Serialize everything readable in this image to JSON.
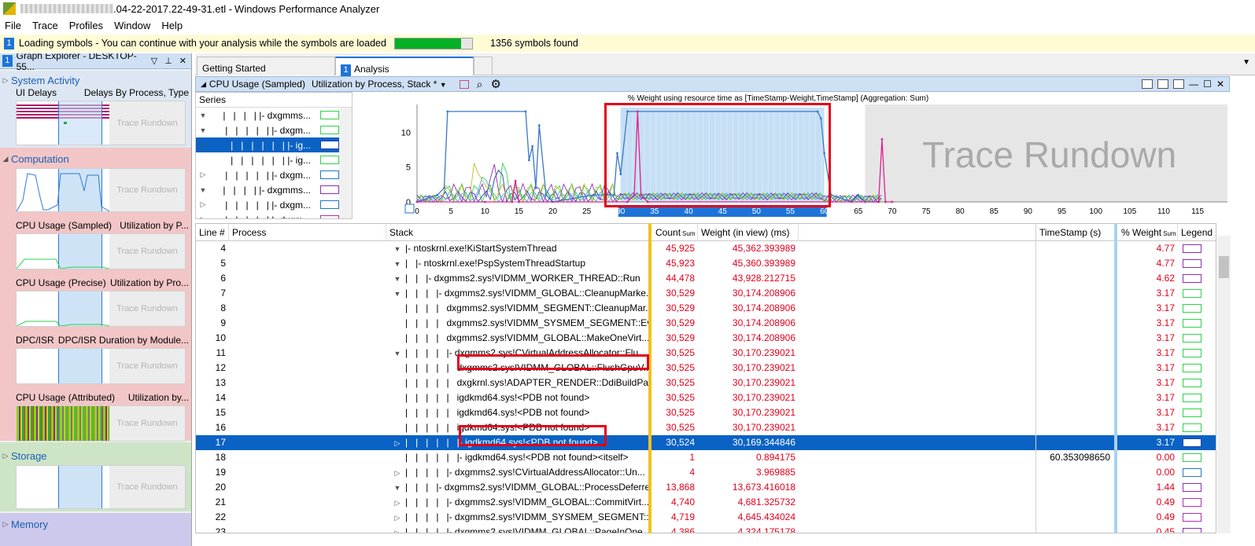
{
  "window": {
    "title_prefix": ".04-22-2017.22-49-31.etl - ",
    "title_suffix": "Windows Performance Analyzer"
  },
  "menu": [
    "File",
    "Trace",
    "Profiles",
    "Window",
    "Help"
  ],
  "info": {
    "badge": "1",
    "message": "Loading symbols - You can continue with your analysis while the symbols are loaded",
    "progress": 0.86,
    "symbols": "1356 symbols found"
  },
  "explorer": {
    "badge": "1",
    "title": "Graph Explorer - DESKTOP-55...",
    "categories": [
      {
        "name": "System Activity",
        "items": [
          {
            "name": "UI Delays",
            "detail": "Delays By Process, Type"
          }
        ]
      },
      {
        "name": "Computation",
        "items": [
          {
            "name": "CPU Usage (Sampled)",
            "detail": "Utilization by P..."
          },
          {
            "name": "CPU Usage (Precise)",
            "detail": "Utilization by Pro..."
          },
          {
            "name": "DPC/ISR",
            "detail": "DPC/ISR Duration by Module..."
          },
          {
            "name": "CPU Usage (Attributed)",
            "detail": "Utilization by..."
          }
        ]
      },
      {
        "name": "Storage",
        "items": []
      },
      {
        "name": "Memory",
        "items": []
      }
    ],
    "rundown": "Trace Rundown"
  },
  "tabs": [
    {
      "label": "Getting Started"
    },
    {
      "badge": "1",
      "label": "Analysis"
    }
  ],
  "graph": {
    "title": "CPU Usage (Sampled)",
    "preset": "Utilization by Process, Stack *",
    "series_header": "Series",
    "series": [
      {
        "label": "|- dxgmms...",
        "expand": "▼",
        "color": "#2fd24a"
      },
      {
        "label": "|- dxgm...",
        "expand": "▼",
        "color": "#2fd24a"
      },
      {
        "label": "|- ig...",
        "expand": "▷",
        "color": "#1d3fb5",
        "selected": true
      },
      {
        "label": "|- ig...",
        "expand": "",
        "color": "#2fd24a"
      },
      {
        "label": "|- dxgm...",
        "expand": "▷",
        "color": "#1f78c8"
      },
      {
        "label": "|- dxgmms...",
        "expand": "▼",
        "color": "#8a2fb8"
      },
      {
        "label": "|- dxgm...",
        "expand": "▷",
        "color": "#1f78c8"
      },
      {
        "label": "|- dxgm...",
        "expand": "▷",
        "color": "#b02fb8"
      }
    ]
  },
  "chart_data": {
    "type": "line",
    "title": "% Weight using resource time as [TimeStamp-Weight,TimeStamp] (Aggregation: Sum)",
    "xlim": [
      0,
      118
    ],
    "ylim": [
      0,
      14
    ],
    "xticks": [
      0,
      5,
      10,
      15,
      20,
      25,
      30,
      35,
      40,
      45,
      50,
      55,
      60,
      65,
      70,
      75,
      80,
      85,
      90,
      95,
      100,
      105,
      110,
      115
    ],
    "yticks": [
      0,
      5,
      10
    ],
    "selection": [
      30,
      60
    ],
    "rundown_start": 66,
    "rundown_label": "Trace Rundown",
    "series": [
      {
        "name": "top",
        "color": "#3a78c8",
        "x": [
          0,
          3,
          4,
          4.5,
          16,
          16.5,
          17,
          17.5,
          18,
          19,
          20,
          26,
          29,
          29.5,
          30,
          31,
          59,
          59.5,
          60,
          61,
          64,
          65,
          66,
          68
        ],
        "y": [
          0,
          1,
          2,
          13,
          13,
          6,
          8,
          2,
          11,
          1,
          0,
          1,
          1,
          7,
          4,
          13,
          13,
          12,
          7,
          1,
          0,
          1,
          0,
          0
        ]
      },
      {
        "name": "spikes",
        "color": "#e0208c",
        "x": [
          0,
          10,
          14,
          14.5,
          15,
          31,
          32,
          32.5,
          33,
          34,
          68,
          68.5,
          69,
          70
        ],
        "y": [
          0,
          0,
          0,
          3,
          0,
          0,
          1,
          13,
          1,
          0,
          0,
          9,
          0,
          0
        ]
      }
    ]
  },
  "table": {
    "columns": {
      "line": "Line #",
      "process": "Process",
      "stack": "Stack",
      "count": "Count",
      "count_sub": "Sum",
      "weight": "Weight (in view) (ms)",
      "timestamp": "TimeStamp (s)",
      "pct": "% Weight",
      "pct_sub": "Sum",
      "legend": "Legend"
    },
    "rows": [
      {
        "line": "4",
        "exp": "▼",
        "indent": "|- ",
        "stack": "ntoskrnl.exe!KiStartSystemThread",
        "count": "45,925",
        "weight": "45,362.393989",
        "ts": "",
        "pct": "4.77",
        "color": "#8a2fb8"
      },
      {
        "line": "5",
        "exp": "▼",
        "indent": "|   |- ",
        "stack": "ntoskrnl.exe!PspSystemThreadStartup",
        "count": "45,923",
        "weight": "45,360.393989",
        "ts": "",
        "pct": "4.77",
        "color": "#8a2fb8"
      },
      {
        "line": "6",
        "exp": "▼",
        "indent": "|   |   |- ",
        "stack": "dxgmms2.sys!VIDMM_WORKER_THREAD::Run",
        "count": "44,478",
        "weight": "43,928.212715",
        "ts": "",
        "pct": "4.62",
        "color": "#8a2fb8"
      },
      {
        "line": "7",
        "exp": "▼",
        "indent": "|   |   |   |- ",
        "stack": "dxgmms2.sys!VIDMM_GLOBAL::CleanupMarke...",
        "count": "30,529",
        "weight": "30,174.208906",
        "ts": "",
        "pct": "3.17",
        "color": "#2fd24a"
      },
      {
        "line": "8",
        "exp": "",
        "indent": "|   |   |   |   ",
        "stack": "dxgmms2.sys!VIDMM_SEGMENT::CleanupMar...",
        "count": "30,529",
        "weight": "30,174.208906",
        "ts": "",
        "pct": "3.17",
        "color": "#2fd24a"
      },
      {
        "line": "9",
        "exp": "",
        "indent": "|   |   |   |   ",
        "stack": "dxgmms2.sys!VIDMM_SYSMEM_SEGMENT::Ev...",
        "count": "30,529",
        "weight": "30,174.208906",
        "ts": "",
        "pct": "3.17",
        "color": "#2fd24a"
      },
      {
        "line": "10",
        "exp": "",
        "indent": "|   |   |   |   ",
        "stack": "dxgmms2.sys!VIDMM_GLOBAL::MakeOneVirt...",
        "count": "30,529",
        "weight": "30,174.208906",
        "ts": "",
        "pct": "3.17",
        "color": "#2fd24a"
      },
      {
        "line": "11",
        "exp": "▼",
        "indent": "|   |   |   |   |- ",
        "stack": "dxgmms2.sys!CVirtualAddressAllocator::Flu...",
        "count": "30,525",
        "weight": "30,170.239021",
        "ts": "",
        "pct": "3.17",
        "color": "#2fd24a"
      },
      {
        "line": "12",
        "exp": "",
        "indent": "|   |   |   |   |   ",
        "stack": "dxgmms2.sys!VIDMM_GLOBAL::FlushGpuV...",
        "count": "30,525",
        "weight": "30,170.239021",
        "ts": "",
        "pct": "3.17",
        "color": "#2fd24a"
      },
      {
        "line": "13",
        "exp": "",
        "indent": "|   |   |   |   |   ",
        "stack": "dxgkrnl.sys!ADAPTER_RENDER::DdiBuildPa...",
        "count": "30,525",
        "weight": "30,170.239021",
        "ts": "",
        "pct": "3.17",
        "color": "#2fd24a"
      },
      {
        "line": "14",
        "exp": "",
        "indent": "|   |   |   |   |   ",
        "stack": "igdkmd64.sys!<PDB not found>",
        "count": "30,525",
        "weight": "30,170.239021",
        "ts": "",
        "pct": "3.17",
        "color": "#2fd24a"
      },
      {
        "line": "15",
        "exp": "",
        "indent": "|   |   |   |   |   ",
        "stack": "igdkmd64.sys!<PDB not found>",
        "count": "30,525",
        "weight": "30,170.239021",
        "ts": "",
        "pct": "3.17",
        "color": "#2fd24a"
      },
      {
        "line": "16",
        "exp": "",
        "indent": "|   |   |   |   |   ",
        "stack": "igdkmd64.sys!<PDB not found>",
        "count": "30,525",
        "weight": "30,170.239021",
        "ts": "",
        "pct": "3.17",
        "color": "#2fd24a"
      },
      {
        "line": "17",
        "exp": "▷",
        "indent": "|   |   |   |   |   |- ",
        "stack": "igdkmd64.sys!<PDB not found>",
        "count": "30,524",
        "weight": "30,169.344846",
        "ts": "",
        "pct": "3.17",
        "color": "#1d3fb5",
        "selected": true
      },
      {
        "line": "18",
        "exp": "",
        "indent": "|   |   |   |   |   |- ",
        "stack": "igdkmd64.sys!<PDB not found><itself>",
        "count": "1",
        "weight": "0.894175",
        "ts": "60.353098650",
        "pct": "0.00",
        "color": "#2fd24a"
      },
      {
        "line": "19",
        "exp": "▷",
        "indent": "|   |   |   |   |- ",
        "stack": "dxgmms2.sys!CVirtualAddressAllocator::Un...",
        "count": "4",
        "weight": "3.969885",
        "ts": "",
        "pct": "0.00",
        "color": "#1f78c8"
      },
      {
        "line": "20",
        "exp": "▼",
        "indent": "|   |   |   |- ",
        "stack": "dxgmms2.sys!VIDMM_GLOBAL::ProcessDeferre...",
        "count": "13,868",
        "weight": "13,673.416018",
        "ts": "",
        "pct": "1.44",
        "color": "#8a2fb8"
      },
      {
        "line": "21",
        "exp": "▷",
        "indent": "|   |   |   |   |- ",
        "stack": "dxgmms2.sys!VIDMM_GLOBAL::CommitVirt...",
        "count": "4,740",
        "weight": "4,681.325732",
        "ts": "",
        "pct": "0.49",
        "color": "#b02fb8"
      },
      {
        "line": "22",
        "exp": "▷",
        "indent": "|   |   |   |   |- ",
        "stack": "dxgmms2.sys!VIDMM_SYSMEM_SEGMENT::...",
        "count": "4,719",
        "weight": "4,645.434024",
        "ts": "",
        "pct": "0.49",
        "color": "#b02fb8"
      },
      {
        "line": "23",
        "exp": "▷",
        "indent": "|   |   |   |   |- ",
        "stack": "dxgmms2.sys!VIDMM_GLOBAL::PageInOne...",
        "count": "4,386",
        "weight": "4,324.175178",
        "ts": "",
        "pct": "0.45",
        "color": "#8a2fb8"
      }
    ]
  }
}
